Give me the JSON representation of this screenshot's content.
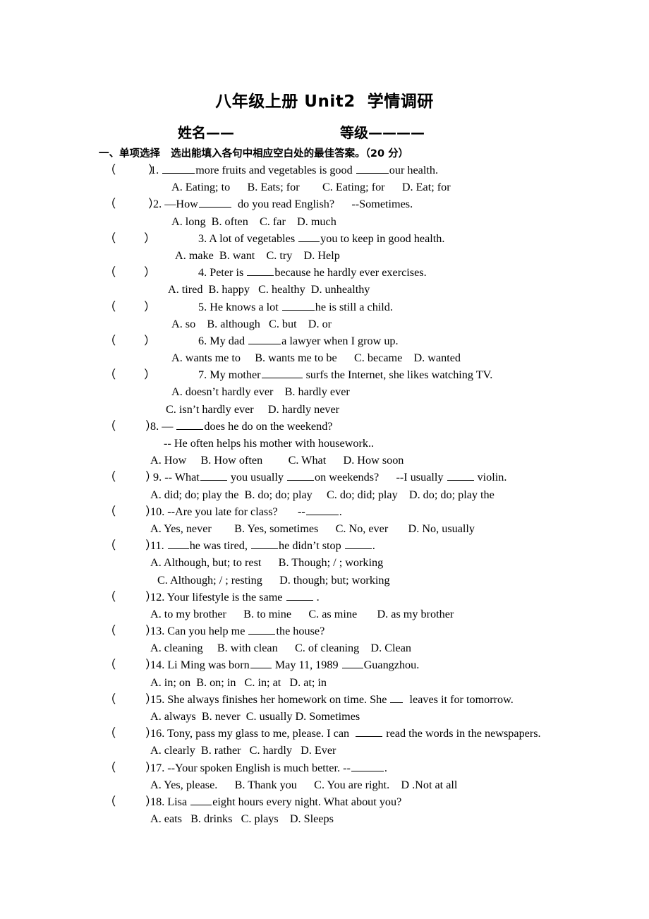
{
  "document": {
    "title": "八年级上册 Unit2  学情调研",
    "name_field_label": "姓名——",
    "grade_field_label": "等级————",
    "section_heading": "一、单项选择   选出能填入各句中相应空白处的最佳答案。（20 分）"
  },
  "paren_open": "（",
  "paren_close": "）",
  "questions": [
    {
      "number": "1.",
      "stem_pre": "1. ",
      "stem_parts": [
        "1. ",
        "more fruits and vegetables is good ",
        "our health."
      ],
      "options": "A. Eating; to      B. Eats; for        C. Eating; for      D. Eat; for",
      "indent": 213,
      "opt_indent": 243,
      "paren_gap": 46
    },
    {
      "number": "2.",
      "stem_parts": [
        "2. —How",
        "  do you read English?      --Sometimes."
      ],
      "options": "A. long  B. often    C. far    D. much",
      "indent": 217,
      "opt_indent": 243,
      "paren_gap": 46
    },
    {
      "number": "3.",
      "stem_parts": [
        "3. A lot of vegetables ",
        "you to keep in good health."
      ],
      "options": "A. make  B. want    C. try    D. Help",
      "indent": 281,
      "opt_indent": 248,
      "paren_gap": 40
    },
    {
      "number": "4.",
      "stem_parts": [
        "4. Peter is ",
        "because he hardly ever exercises."
      ],
      "options": "A. tired  B. happy   C. healthy  D. unhealthy",
      "indent": 281,
      "opt_indent": 238,
      "paren_gap": 40
    },
    {
      "number": "5.",
      "stem_parts": [
        "5. He knows a lot ",
        "he is still a child."
      ],
      "options": "A. so    B. although   C. but    D. or",
      "indent": 281,
      "opt_indent": 243,
      "paren_gap": 40
    },
    {
      "number": "6.",
      "stem_parts": [
        "6. My dad ",
        "a lawyer when I grow up."
      ],
      "options": "A. wants me to     B. wants me to be      C. became    D. wanted",
      "indent": 281,
      "opt_indent": 243,
      "paren_gap": 40
    },
    {
      "number": "7.",
      "stem_parts": [
        "7. My mother",
        " surfs the Internet, she likes watching TV."
      ],
      "options": "A. doesn’t hardly ever    B. hardly ever",
      "options2": "C. isn’t hardly ever     D. hardly never",
      "indent": 281,
      "opt_indent": 243,
      "opt2_indent": 235,
      "paren_gap": 40
    },
    {
      "number": "8.",
      "stem_parts": [
        "8. — ",
        "does he do on the weekend?"
      ],
      "extra_line": "-- He often helps his mother with housework..",
      "extra_indent": 232,
      "options": "A. How     B. How often         C. What      D. How soon",
      "indent": 213,
      "opt_indent": 213,
      "paren_gap": 42
    },
    {
      "number": "9.",
      "stem_parts": [
        "9. -- What",
        " you usually ",
        "on weekends?      --I usually ",
        " violin."
      ],
      "options": "A. did; do; play the  B. do; do; play     C. do; did; play    D. do; do; play the",
      "indent": 217,
      "opt_indent": 213,
      "paren_gap": 42
    },
    {
      "number": "10.",
      "stem_parts": [
        "10. --Are you late for class?       --",
        "."
      ],
      "options": "A. Yes, never        B. Yes, sometimes      C. No, ever       D. No, usually",
      "indent": 213,
      "opt_indent": 213,
      "paren_gap": 42
    },
    {
      "number": "11.",
      "stem_parts": [
        "11. ",
        "he was tired, ",
        "he didn’t stop ",
        "."
      ],
      "options": "A. Although, but; to rest      B. Though; / ; working",
      "options2": "C. Although; / ; resting      D. though; but; working",
      "indent": 213,
      "opt_indent": 213,
      "opt2_indent": 223,
      "paren_gap": 42
    },
    {
      "number": "12.",
      "stem_parts": [
        "12. Your lifestyle is the same ",
        " ."
      ],
      "options": "A. to my brother      B. to mine      C. as mine       D. as my brother",
      "indent": 213,
      "opt_indent": 213,
      "paren_gap": 42
    },
    {
      "number": "13.",
      "stem_parts": [
        "13. Can you help me ",
        "the house?"
      ],
      "options": "A. cleaning     B. with clean      C. of cleaning    D. Clean",
      "indent": 213,
      "opt_indent": 213,
      "paren_gap": 42
    },
    {
      "number": "14.",
      "stem_parts": [
        "14. Li Ming was born",
        " May 11, 1989 ",
        "Guangzhou."
      ],
      "options": "A. in; on  B. on; in   C. in; at   D. at; in",
      "indent": 213,
      "opt_indent": 213,
      "paren_gap": 42
    },
    {
      "number": "15.",
      "stem_parts": [
        "15. She always finishes her homework on time. She ",
        "  leaves it for tomorrow."
      ],
      "options": "A. always  B. never  C. usually D. Sometimes",
      "indent": 213,
      "opt_indent": 213,
      "paren_gap": 42
    },
    {
      "number": "16.",
      "stem_parts": [
        "16. Tony, pass my glass to me, please. I can  ",
        " read the words in the newspapers."
      ],
      "options": "A. clearly  B. rather   C. hardly   D. Ever",
      "indent": 213,
      "opt_indent": 213,
      "paren_gap": 42
    },
    {
      "number": "17.",
      "stem_parts": [
        "17. --Your spoken English is much better. --",
        "."
      ],
      "options": "A. Yes, please.      B. Thank you      C. You are right.    D .Not at all",
      "indent": 213,
      "opt_indent": 213,
      "paren_gap": 42
    },
    {
      "number": "18.",
      "stem_parts": [
        "18. Lisa ",
        "eight hours every night. What about you?"
      ],
      "options": "A. eats   B. drinks   C. plays    D. Sleeps",
      "indent": 213,
      "opt_indent": 213,
      "paren_gap": 42
    }
  ]
}
